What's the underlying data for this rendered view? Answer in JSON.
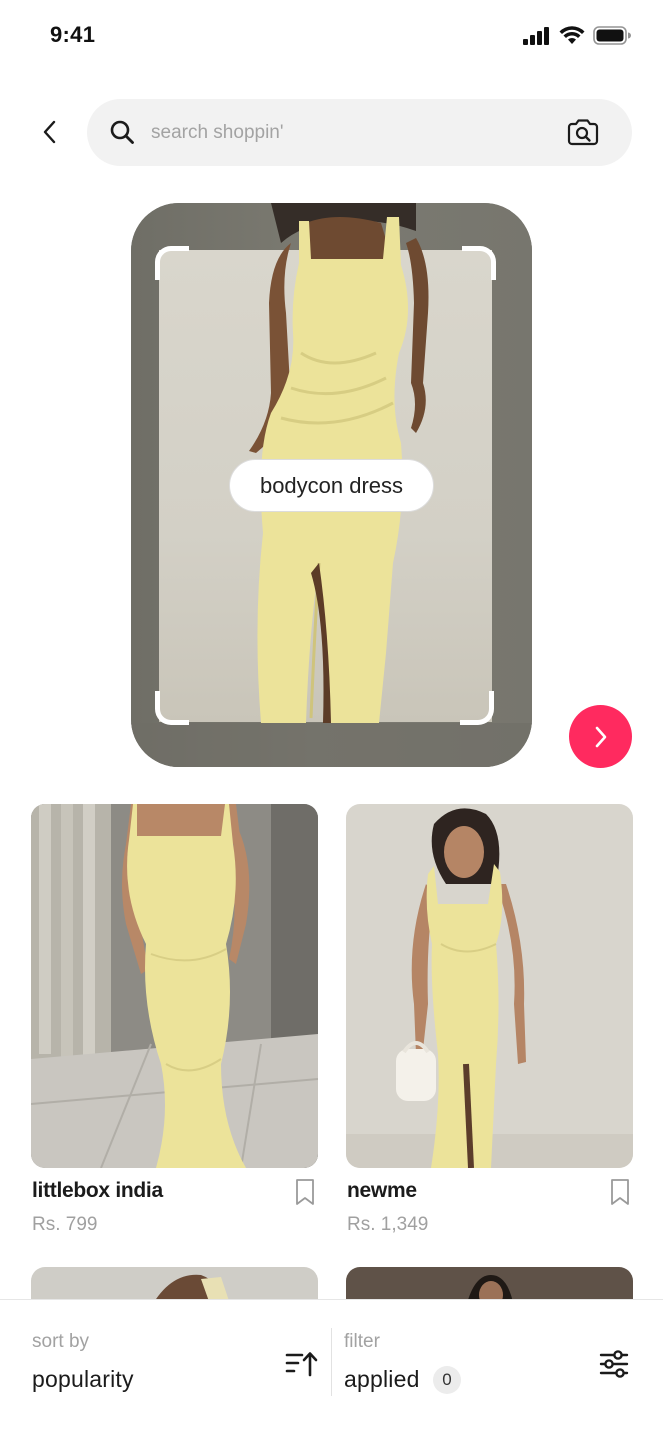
{
  "status_bar": {
    "time": "9:41",
    "icons": [
      "cellular-signal-icon",
      "wifi-icon",
      "battery-icon"
    ]
  },
  "search": {
    "placeholder": "search shoppin'",
    "value": "",
    "icons": [
      "back-chevron-icon",
      "search-icon",
      "camera-search-icon"
    ]
  },
  "scan": {
    "detected_label": "bodycon dress"
  },
  "products": [
    {
      "brand": "littlebox india",
      "price": "Rs. 799"
    },
    {
      "brand": "newme",
      "price": "Rs. 1,349"
    }
  ],
  "bottom_bar": {
    "sort_label": "sort by",
    "sort_value": "popularity",
    "filter_label": "filter",
    "filter_value": "applied",
    "filter_count": "0"
  },
  "colors": {
    "accent": "#ff2a5f",
    "search_bg": "#f2f2f2",
    "dress": "#ece39a",
    "muted_text": "#a0a0a0"
  }
}
